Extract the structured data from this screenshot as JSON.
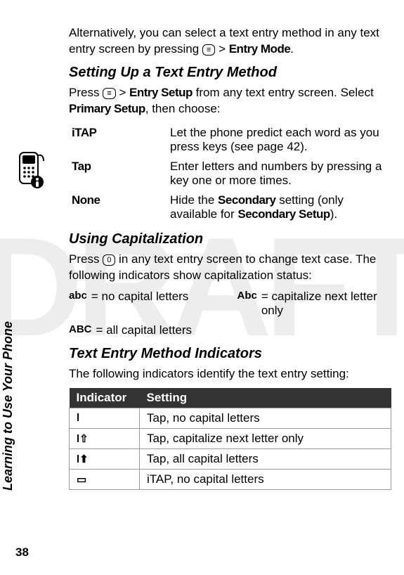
{
  "watermark": "DRAFT",
  "side_tab": "Learning to Use Your Phone",
  "page_number": "38",
  "intro": {
    "pre": "Alternatively, you can select a text entry method in any text entry screen by pressing ",
    "key_glyph": "≡",
    "sep": " > ",
    "menu": "Entry Mode",
    "post": "."
  },
  "section1": {
    "title": "Setting Up a Text Entry Method",
    "para_pre": "Press ",
    "key_glyph": "≡",
    "sep": " > ",
    "menu1": "Entry Setup",
    "para_mid": " from any text entry screen. Select ",
    "menu2": "Primary Setup",
    "para_post": ", then choose:",
    "rows": [
      {
        "label": "iTAP",
        "desc_pre": "Let the phone predict each word as you press keys (see page ",
        "page_ref": "42",
        "desc_post": ")."
      },
      {
        "label": "Tap",
        "desc": "Enter letters and numbers by pressing a key one or more times."
      },
      {
        "label": "None",
        "desc_pre": "Hide the ",
        "em1": "Secondary",
        "desc_mid": " setting (only available for ",
        "em2": "Secondary Setup",
        "desc_post": ")."
      }
    ]
  },
  "section2": {
    "title": "Using Capitalization",
    "para_pre": "Press ",
    "key_glyph": "0",
    "para_post": " in any text entry screen to change text case. The following indicators show capitalization status:",
    "items": [
      {
        "glyph": "abc",
        "text": "no capital letters"
      },
      {
        "glyph": "Abc",
        "text": "capitalize next letter only"
      },
      {
        "glyph": "ABC",
        "text": "all capital letters"
      }
    ]
  },
  "section3": {
    "title": "Text Entry Method Indicators",
    "para": "The following indicators identify the text entry setting:",
    "headers": [
      "Indicator",
      "Setting"
    ],
    "rows": [
      {
        "ind": "l",
        "setting": "Tap, no capital letters"
      },
      {
        "ind": "l⇧",
        "setting": "Tap, capitalize next letter only"
      },
      {
        "ind": "l⬆",
        "setting": "Tap, all capital letters"
      },
      {
        "ind": "▭",
        "setting": "iTAP, no capital letters"
      }
    ]
  }
}
